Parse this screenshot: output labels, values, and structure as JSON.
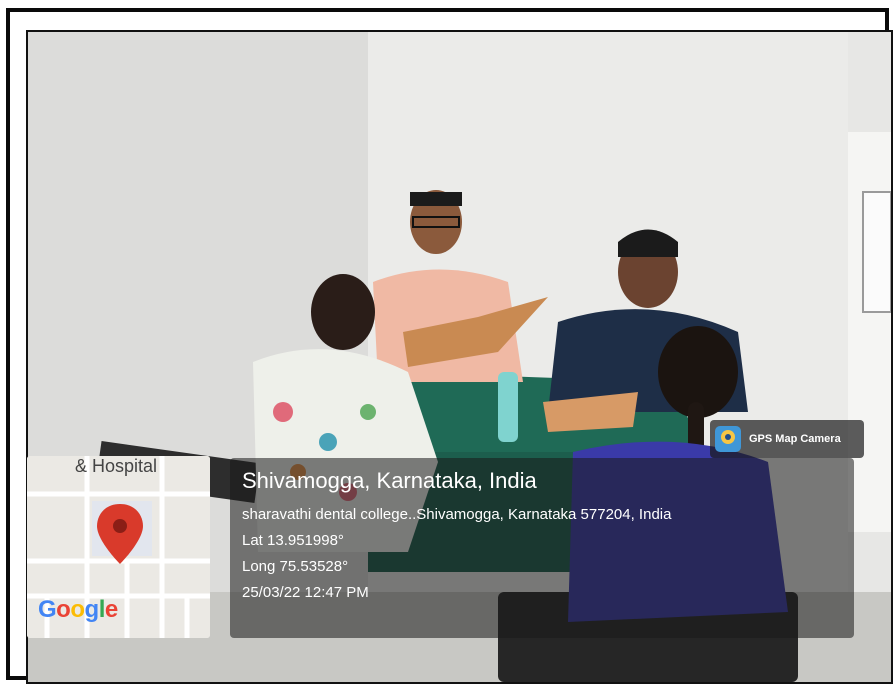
{
  "map": {
    "place_label": "& Hospital",
    "brand": "Google"
  },
  "camera_badge": {
    "label": "GPS Map Camera",
    "icon": "map-camera-icon"
  },
  "location": {
    "title": "Shivamogga, Karnataka, India",
    "address": "sharavathi dental college..Shivamogga, Karnataka 577204, India",
    "lat": "Lat 13.951998°",
    "long": "Long 75.53528°",
    "datetime": "25/03/22 12:47 PM"
  }
}
